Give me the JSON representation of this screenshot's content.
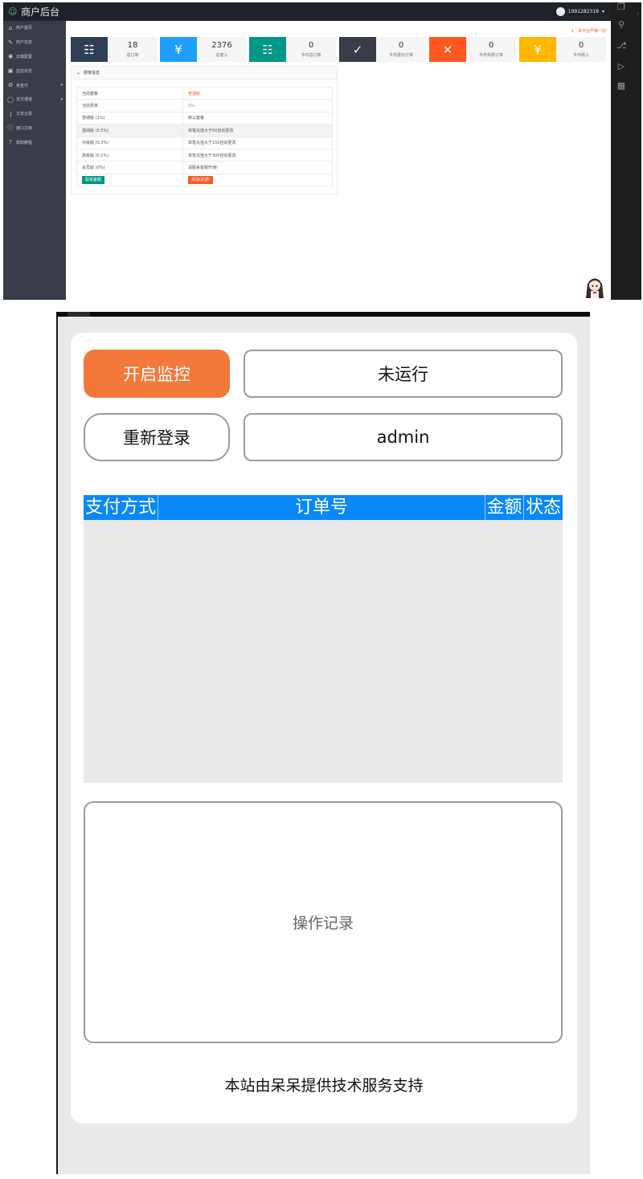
{
  "admin": {
    "brand_title": "商户后台",
    "user_name": "1991282318",
    "notice": "1、本平台严禁一切",
    "sidebar": [
      {
        "label": "商户首页",
        "icon": "home-icon"
      },
      {
        "label": "商户信息",
        "icon": "edit-icon"
      },
      {
        "label": "云端配置",
        "icon": "settings-icon"
      },
      {
        "label": "监控状态",
        "icon": "monitor-icon"
      },
      {
        "label": "免签付",
        "icon": "settings-icon",
        "arrow": "▾"
      },
      {
        "label": "支付通道",
        "icon": "shield-icon",
        "arrow": "▾"
      },
      {
        "label": "订单记录",
        "icon": "cart-icon"
      },
      {
        "label": "接口文档",
        "icon": "info-icon"
      },
      {
        "label": "帮助教程",
        "icon": "help-icon"
      }
    ],
    "stats": [
      {
        "value": "18",
        "label": "总订单",
        "icon": "clipboard-icon",
        "color": "#2F4056"
      },
      {
        "value": "2376",
        "label": "总收入",
        "icon": "yen-icon",
        "color": "#1E9FFF"
      },
      {
        "value": "0",
        "label": "今日总订单",
        "icon": "clipboard-icon",
        "color": "#009688"
      },
      {
        "value": "0",
        "label": "今日成功订单",
        "icon": "check-icon",
        "color": "#393D49"
      },
      {
        "value": "0",
        "label": "今日失败订单",
        "icon": "close-icon",
        "color": "#FF5722"
      },
      {
        "value": "0",
        "label": "今日收入",
        "icon": "yen-icon",
        "color": "#FFB800"
      }
    ],
    "rate_panel": {
      "title": "费率信息",
      "rows": [
        {
          "name": "当前套餐",
          "desc": "普通版",
          "red": true
        },
        {
          "name": "当前费率",
          "desc": "1%",
          "red": true
        },
        {
          "name": "普通版 (1%)",
          "desc": "默认套餐"
        },
        {
          "name": "基础版 (0.5%)",
          "desc": "单笔充值大于50自动更改",
          "highlight": true
        },
        {
          "name": "中级版 (0.3%)",
          "desc": "单笔充值大于150自动更改"
        },
        {
          "name": "高级版 (0.1%)",
          "desc": "单笔充值大于300自动更改"
        },
        {
          "name": "会员版 (0%)",
          "desc": "请联系客服开通!"
        }
      ],
      "contact_button": "联系客服",
      "qq_button": "添加QQ群"
    }
  },
  "phone": {
    "start_button": "开启监控",
    "status_text": "未运行",
    "relogin_button": "重新登录",
    "username": "admin",
    "order_columns": [
      "支付方式",
      "订单号",
      "金额",
      "状态"
    ],
    "log_placeholder": "操作记录",
    "footer": "本站由呆呆提供技术服务支持"
  }
}
